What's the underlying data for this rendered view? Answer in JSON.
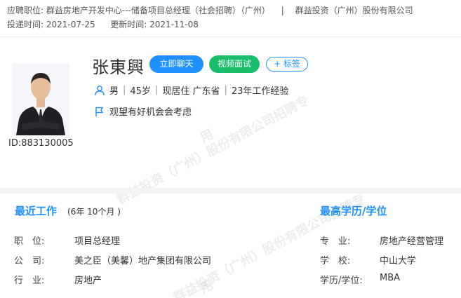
{
  "header": {
    "applied_label": "应聘职位:",
    "applied_position": "群益房地产开发中心---储备项目总经理（社会招聘）（广州）",
    "separator": "|",
    "company": "群益投资（广州）股份有限公司",
    "submitted_label": "投递时间:",
    "submitted_time": "2021-07-25",
    "updated_label": "更新时间:",
    "updated_time": "2021-11-08"
  },
  "candidate": {
    "name": "张東興",
    "id_text": "ID:883130005",
    "gender": "男",
    "age": "45岁",
    "residence": "现居住 广东省",
    "experience": "23年工作经验",
    "status": "观望有好机会会考虑"
  },
  "actions": {
    "chat_label": "立即聊天",
    "video_label": "视频面试",
    "tag_label": "+ 标签"
  },
  "watermark": {
    "line1": "群益投资（广州）股份有限公司招聘专",
    "line2": "用"
  },
  "recent_work": {
    "title": "最近工作",
    "duration": "(6年 10个月 )",
    "position_label": "职　位:",
    "position_value": "项目总经理",
    "company_label": "公　司:",
    "company_value": "美之臣（美馨）地产集团有限公司",
    "industry_label": "行　业:",
    "industry_value": "房地产"
  },
  "education": {
    "title": "最高学历/学位",
    "major_label": "专　业:",
    "major_value": "房地产经营管理",
    "school_label": "学　校:",
    "school_value": "中山大学",
    "degree_label": "学历/学位:",
    "degree_value": "MBA"
  },
  "colors": {
    "accent": "#1e90ff",
    "video_green": "#19be6b",
    "divider": "#f2f3f5"
  }
}
